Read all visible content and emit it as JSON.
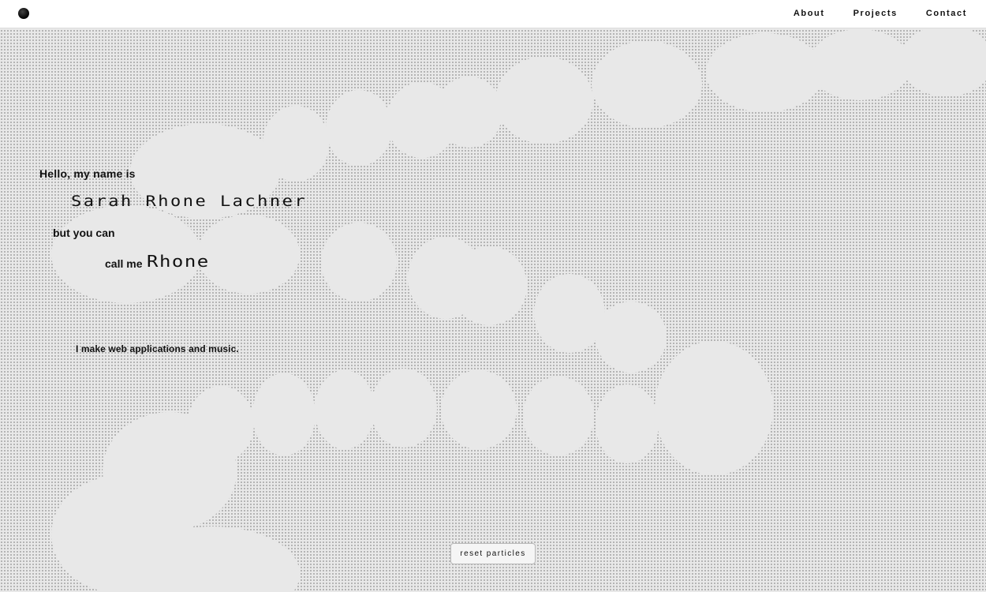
{
  "nav": {
    "logo": "logo-dot",
    "links": [
      "About",
      "Projects",
      "Contact"
    ]
  },
  "hero": {
    "greeting": "Hello, my name is",
    "full_name": "Sarah Rhone Lachner",
    "transition": "but you can",
    "call_me": "call me",
    "nickname": "Rhone",
    "tagline": "I make web applications and music."
  },
  "controls": {
    "reset_label": "reset particles"
  },
  "colors": {
    "background": "#e8e8e8",
    "nav_background": "#ffffff",
    "particle": "#9a9a9a",
    "text": "#111111"
  }
}
